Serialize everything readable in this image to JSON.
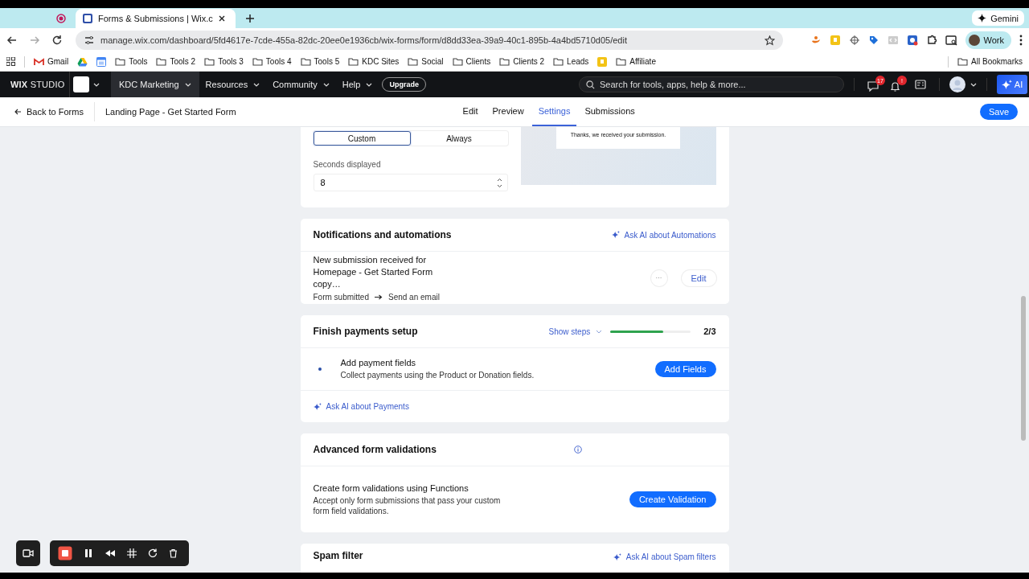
{
  "browser": {
    "tabs": [
      {
        "kind": "recording",
        "selected": false
      },
      {
        "kind": "page",
        "title": "Forms & Submissions | Wix.c",
        "selected": true
      }
    ],
    "gemini": "Gemini",
    "url": "manage.wix.com/dashboard/5fd4617e-7cde-455a-82dc-20ee0e1936cb/wix-forms/form/d8dd33ea-39a9-40c1-895b-4a4bd5710d05/edit",
    "profile": "Work",
    "bookmarks": [
      {
        "kind": "gmail",
        "label": "Gmail"
      },
      {
        "kind": "drive"
      },
      {
        "kind": "calendar"
      },
      {
        "kind": "folder",
        "label": "Tools"
      },
      {
        "kind": "folder",
        "label": "Tools 2"
      },
      {
        "kind": "folder",
        "label": "Tools 3"
      },
      {
        "kind": "folder",
        "label": "Tools 4"
      },
      {
        "kind": "folder",
        "label": "Tools 5"
      },
      {
        "kind": "folder",
        "label": "KDC Sites"
      },
      {
        "kind": "folder",
        "label": "Social"
      },
      {
        "kind": "folder",
        "label": "Clients"
      },
      {
        "kind": "folder",
        "label": "Clients 2"
      },
      {
        "kind": "folder",
        "label": "Leads"
      },
      {
        "kind": "keep"
      },
      {
        "kind": "folder",
        "label": "Affiliate"
      }
    ],
    "all_bookmarks": "All Bookmarks"
  },
  "wix_bar": {
    "logo": "**WIX** STUDIO",
    "site": "KDC Marketing",
    "menus": [
      "Resources",
      "Community",
      "Help"
    ],
    "upgrade": "Upgrade",
    "search_placeholder": "Search for tools, apps, help & more...",
    "messages_badge": "17",
    "notifications_badge": "!",
    "ai": "AI"
  },
  "subnav": {
    "back": "Back to Forms",
    "form_name": "Landing Page - Get Started Form",
    "tabs": [
      {
        "label": "Edit",
        "selected": false
      },
      {
        "label": "Preview",
        "selected": false
      },
      {
        "label": "Settings",
        "selected": true
      },
      {
        "label": "Submissions",
        "selected": false
      }
    ],
    "save": "Save"
  },
  "message_card": {
    "options": [
      {
        "label": "Custom",
        "selected": true
      },
      {
        "label": "Always",
        "selected": false
      }
    ],
    "seconds_label": "Seconds displayed",
    "seconds_value": "8",
    "preview_text": "Thanks, we received your submission."
  },
  "notifications": {
    "title": "Notifications and automations",
    "ask_ai": "Ask AI about Automations",
    "automation": {
      "title": "New submission received for Homepage - Get Started Form copy…",
      "trigger": "Form submitted",
      "action": "Send an email",
      "more": "···",
      "edit": "Edit"
    }
  },
  "payments": {
    "title": "Finish payments setup",
    "show_steps": "Show steps",
    "level": 0.66,
    "progress": "2/3",
    "step": {
      "title": "Add payment fields",
      "description": "Collect payments using the Product or Donation fields.",
      "button": "Add Fields"
    },
    "ask_ai": "Ask AI about Payments"
  },
  "validations": {
    "title": "Advanced form validations",
    "item": {
      "title": "Create form validations using Functions",
      "description": "Accept only form submissions that pass your custom form field validations.",
      "button": "Create Validation"
    }
  },
  "spam": {
    "title": "Spam filter",
    "ask_ai": "Ask AI about Spam filters"
  },
  "recorder": {
    "tools": [
      {
        "kind": "camera"
      },
      {
        "kind": "stop"
      },
      {
        "kind": "pause"
      },
      {
        "kind": "rewind"
      },
      {
        "kind": "grid"
      },
      {
        "kind": "redo"
      },
      {
        "kind": "trash"
      }
    ]
  }
}
